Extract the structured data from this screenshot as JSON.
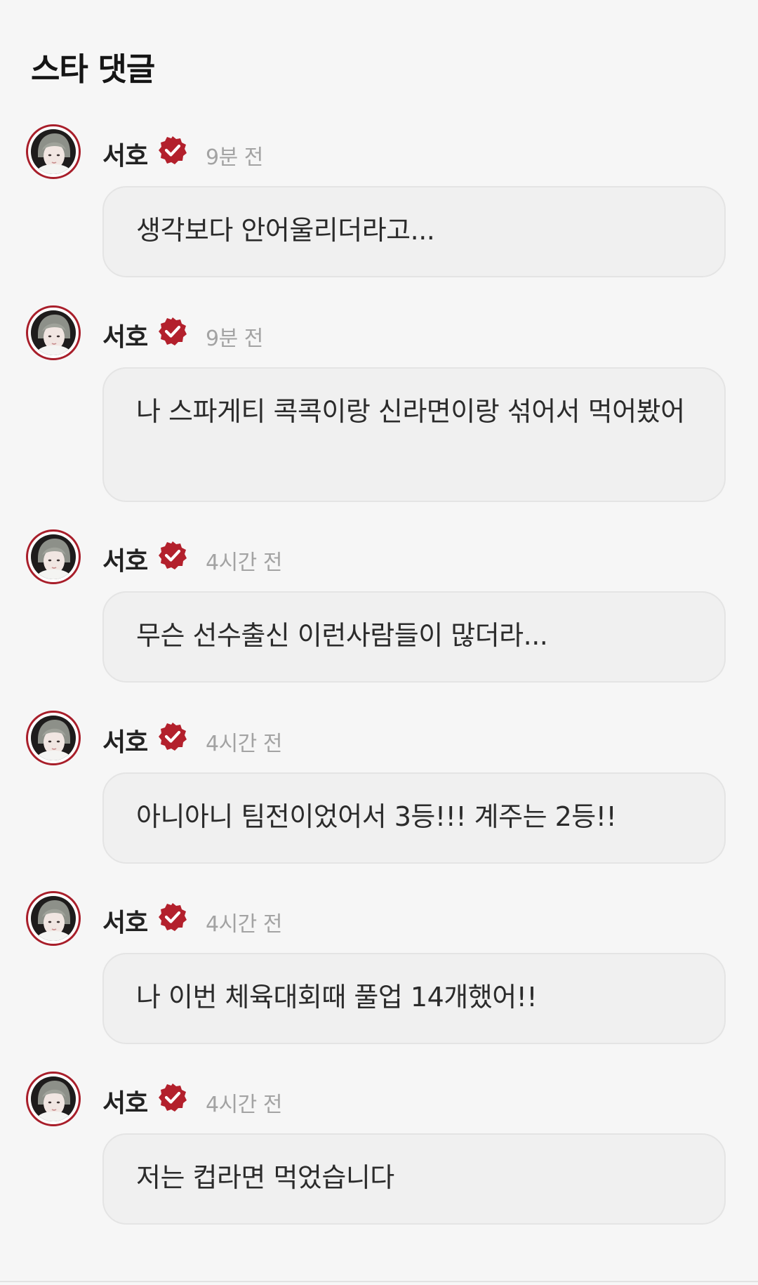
{
  "header": {
    "title": "스타 댓글"
  },
  "colors": {
    "accent": "#a81e2a",
    "background": "#f6f6f6",
    "bubble": "#f0f0f0",
    "timestamp": "#a3a3a3"
  },
  "comments": [
    {
      "author": "서호",
      "time": "9분 전",
      "text": "생각보다 안어울리더라고..."
    },
    {
      "author": "서호",
      "time": "9분 전",
      "text": "나 스파게티 콕콕이랑 신라면이랑 섞어서 먹어봤어"
    },
    {
      "author": "서호",
      "time": "4시간 전",
      "text": "무슨 선수출신 이런사람들이 많더라..."
    },
    {
      "author": "서호",
      "time": "4시간 전",
      "text": "아니아니 팀전이었어서 3등!!! 계주는 2등!!"
    },
    {
      "author": "서호",
      "time": "4시간 전",
      "text": "나 이번 체육대회때 풀업 14개했어!!"
    },
    {
      "author": "서호",
      "time": "4시간 전",
      "text": "저는 컵라면 먹었습니다"
    }
  ],
  "icons": {
    "verified": "verified-badge-icon",
    "avatar": "avatar"
  }
}
